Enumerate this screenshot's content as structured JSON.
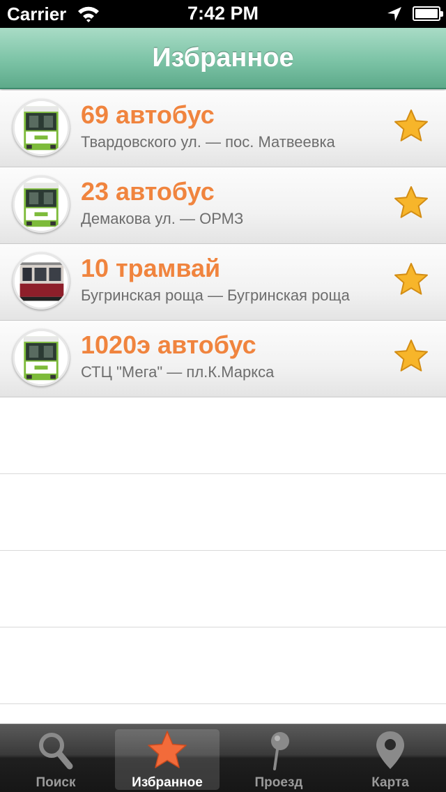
{
  "status_bar": {
    "carrier": "Carrier",
    "time": "7:42 PM"
  },
  "nav": {
    "title": "Избранное"
  },
  "favorites": [
    {
      "route": "69 автобус",
      "stops": "Твардовского ул. — пос. Матвеевка",
      "vehicle": "bus",
      "favorite": true
    },
    {
      "route": "23 автобус",
      "stops": "Демакова ул. — ОРМЗ",
      "vehicle": "bus",
      "favorite": true
    },
    {
      "route": "10 трамвай",
      "stops": "Бугринская роща — Бугринская роща",
      "vehicle": "tram",
      "favorite": true
    },
    {
      "route": "1020э автобус",
      "stops": "СТЦ \"Мега\" — пл.К.Маркса",
      "vehicle": "bus",
      "favorite": true
    }
  ],
  "tabs": [
    {
      "label": "Поиск",
      "icon": "magnifier-icon",
      "active": false
    },
    {
      "label": "Избранное",
      "icon": "star-icon",
      "active": true
    },
    {
      "label": "Проезд",
      "icon": "pin-icon",
      "active": false
    },
    {
      "label": "Карта",
      "icon": "map-marker-icon",
      "active": false
    }
  ],
  "colors": {
    "accent": "#f0843e",
    "nav_green": "#7cc3a6",
    "star": "#f7b52a",
    "tab_active_icon": "#f26b3a"
  }
}
